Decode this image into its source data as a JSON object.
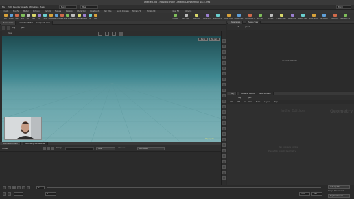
{
  "window": {
    "title": "untitled.hip - Houdini Indie Limited-Commercial 18.5.596"
  },
  "menu": [
    "File",
    "Edit",
    "Render",
    "Assets",
    "Windows",
    "Help"
  ],
  "desktop_combo": "Build",
  "scene_combo": "Main",
  "shelf_tabs": [
    "Create",
    "Modify",
    "Model",
    "Polygon",
    "Deform",
    "Texture",
    "Rigging",
    "Characters",
    "Constraints",
    "Hair Utils",
    "Guide Process",
    "Terrain FX",
    "Simple FX",
    "Cloud FX",
    "Volume"
  ],
  "shelf_tools": [
    "Box",
    "Sphere",
    "Tube",
    "Torus",
    "Grid",
    "Null",
    "Line",
    "Circle",
    "Curve",
    "Draw Curve",
    "Path",
    "Spray Paint",
    "Platonic",
    "L-System",
    "Metaball",
    "File",
    "Font"
  ],
  "shelf_tools_2": [
    "Camera",
    "Point Light",
    "Spot Light",
    "Area Light",
    "Geometry Light",
    "Volume Light",
    "Distant Light",
    "Environment Light",
    "Sky Light",
    "GI Light",
    "Caustic Light",
    "Portal Light",
    "Ambient Light",
    "Stereo Camera",
    "VR Camera",
    "Switcher",
    "Gamepad Camera"
  ],
  "viewport_tabs": [
    "Scene View",
    "Animation Editor",
    "Composite View"
  ],
  "path": "obj",
  "geo_node": "geo1",
  "vp_label": "View",
  "vp_btn_persp": "Persp",
  "vp_btn_cam": "No cam",
  "vp_corner": "Display: 2D",
  "tree_tabs": [
    "Parameters",
    "Scene View"
  ],
  "tree_status": "No node selected",
  "net_tabs": [
    "/obj",
    "Material Palette",
    "Asset Browser"
  ],
  "net_path": "obj",
  "net_menu": [
    "Add",
    "Edit",
    "Go",
    "View",
    "Tools",
    "Layout",
    "Help"
  ],
  "net_label_left": "Indie Edition",
  "net_label_right": "Geometry",
  "net_hint": "Tab to place nodes",
  "net_hint2": "Press Tab to Add Geometry",
  "timeline_tabs": [
    "Animation Editor",
    "Geometry Spreadsheet"
  ],
  "timeline_label": "Nodes",
  "timeline_filter": "Group",
  "timeline_view": "View",
  "timeline_attrib": "Attributes",
  "timeline_intrinsic": "Intrinsic",
  "frame": "1",
  "start": "1",
  "end": "240",
  "end2": "240",
  "auto_update": "Auto Update",
  "keys": "0 keys, 0/0 channels",
  "keys_btn": "Key All Channels"
}
